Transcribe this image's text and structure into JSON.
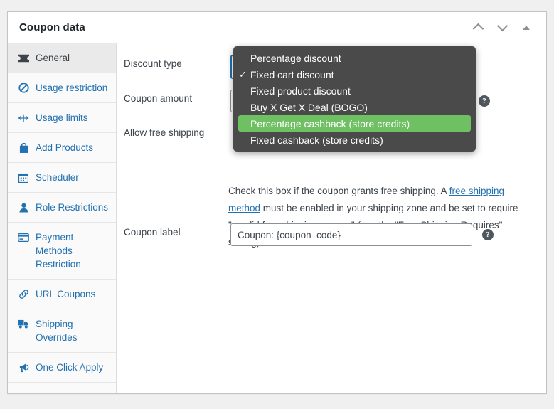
{
  "panel": {
    "title": "Coupon data",
    "controls": [
      {
        "name": "move-up-icon",
        "glyph": "chevron-up"
      },
      {
        "name": "move-down-icon",
        "glyph": "chevron-down"
      },
      {
        "name": "toggle-panel-icon",
        "glyph": "triangle-up"
      }
    ]
  },
  "sidebar": {
    "items": [
      {
        "label": "General",
        "icon": "ticket-icon",
        "active": true
      },
      {
        "label": "Usage restriction",
        "icon": "no-entry-icon",
        "active": false
      },
      {
        "label": "Usage limits",
        "icon": "limits-icon",
        "active": false
      },
      {
        "label": "Add Products",
        "icon": "bag-icon",
        "active": false
      },
      {
        "label": "Scheduler",
        "icon": "calendar-icon",
        "active": false
      },
      {
        "label": "Role Restrictions",
        "icon": "user-icon",
        "active": false
      },
      {
        "label": "Payment Methods Restriction",
        "icon": "card-icon",
        "active": false
      },
      {
        "label": "URL Coupons",
        "icon": "link-icon",
        "active": false
      },
      {
        "label": "Shipping Overrides",
        "icon": "truck-icon",
        "active": false
      },
      {
        "label": "One Click Apply",
        "icon": "megaphone-icon",
        "active": false
      }
    ]
  },
  "form": {
    "discount_type_label": "Discount type",
    "coupon_amount_label": "Coupon amount",
    "allow_free_shipping_label": "Allow free shipping",
    "coupon_label_label": "Coupon label",
    "coupon_label_value": "Coupon: {coupon_code}",
    "coupon_label_placeholder": "Coupon: {coupon_code}",
    "help_glyph": "?",
    "free_shipping_desc_1": "Check this box if the coupon grants free shipping. A ",
    "free_shipping_link": "free shipping method",
    "free_shipping_desc_2": " must be enabled in your shipping zone and be set to require \"a valid free shipping coupon\" (see the \"Free Shipping Requires\" setting)."
  },
  "dropdown": {
    "open": true,
    "check_glyph": "✓",
    "highlight_color": "#6fbf63",
    "background_color": "#4a4a4a",
    "options": [
      {
        "label": "Percentage discount",
        "checked": false,
        "highlighted": false
      },
      {
        "label": "Fixed cart discount",
        "checked": true,
        "highlighted": false
      },
      {
        "label": "Fixed product discount",
        "checked": false,
        "highlighted": false
      },
      {
        "label": "Buy X Get X Deal (BOGO)",
        "checked": false,
        "highlighted": false
      },
      {
        "label": "Percentage cashback (store credits)",
        "checked": false,
        "highlighted": true
      },
      {
        "label": "Fixed cashback (store credits)",
        "checked": false,
        "highlighted": false
      }
    ]
  }
}
